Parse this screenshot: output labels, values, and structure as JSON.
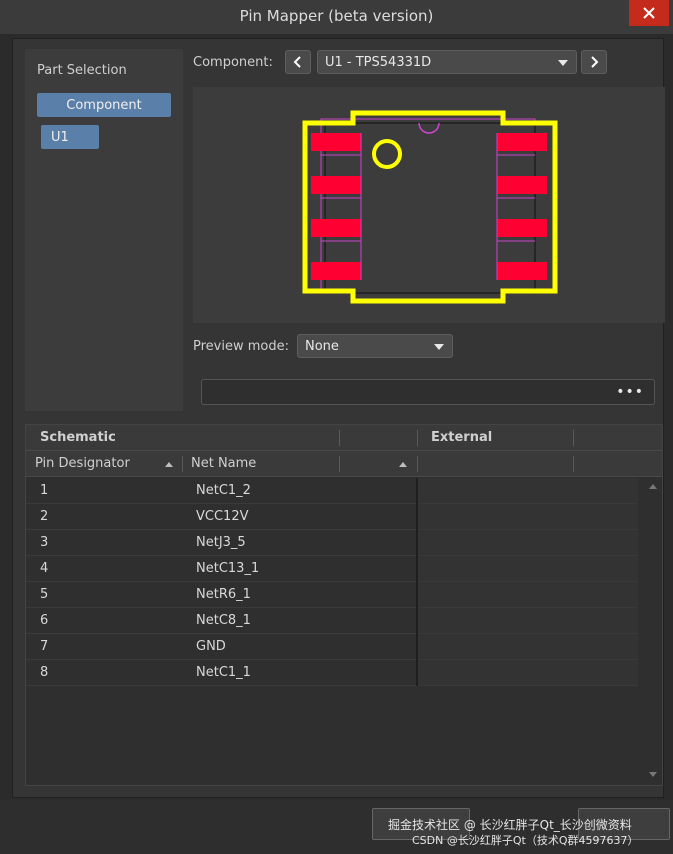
{
  "window": {
    "title": "Pin Mapper (beta version)"
  },
  "part_selection": {
    "label": "Part Selection",
    "component_button": "Component",
    "item": "U1"
  },
  "component_picker": {
    "label": "Component:",
    "value": "U1 - TPS54331D"
  },
  "preview_mode": {
    "label": "Preview mode:",
    "value": "None"
  },
  "description_box": {
    "more_label": "•••"
  },
  "grid": {
    "group_headers": {
      "schematic": "Schematic",
      "external": "External"
    },
    "columns": {
      "pin_designator": "Pin Designator",
      "net_name": "Net Name"
    },
    "rows": [
      {
        "pin": "1",
        "net": "NetC1_2"
      },
      {
        "pin": "2",
        "net": "VCC12V"
      },
      {
        "pin": "3",
        "net": "NetJ3_5"
      },
      {
        "pin": "4",
        "net": "NetC13_1"
      },
      {
        "pin": "5",
        "net": "NetR6_1"
      },
      {
        "pin": "6",
        "net": "NetC8_1"
      },
      {
        "pin": "7",
        "net": "GND"
      },
      {
        "pin": "8",
        "net": "NetC1_1"
      }
    ]
  },
  "footer": {
    "watermark_line1": "掘金技术社区 @ 长沙红胖子Qt_长沙创微资料",
    "watermark_line2": "CSDN @长沙红胖子Qt（技术Q群4597637）"
  },
  "colors": {
    "accent": "#5a7fa8",
    "close": "#c42b1c",
    "silkscreen": "#ffff00",
    "pad": "#ff0033",
    "courtyard": "#cc44cc"
  }
}
